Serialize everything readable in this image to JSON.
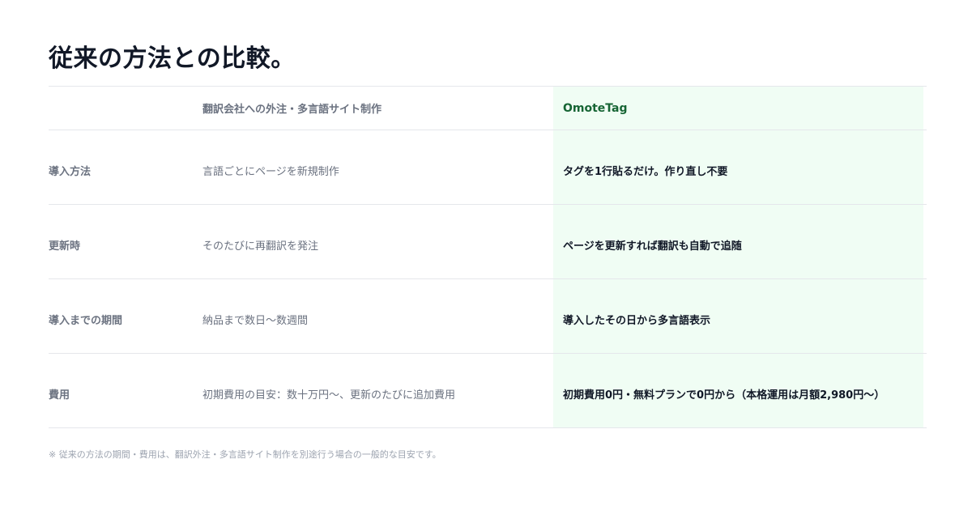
{
  "title": "従来の方法との比較。",
  "columns": {
    "old": "翻訳会社への外注・多言語サイト制作",
    "new": "OmoteTag"
  },
  "rows": [
    {
      "label": "導入方法",
      "old": "言語ごとにページを新規制作",
      "new": "タグを1行貼るだけ。作り直し不要"
    },
    {
      "label": "更新時",
      "old": "そのたびに再翻訳を発注",
      "new": "ページを更新すれば翻訳も自動で追随"
    },
    {
      "label": "導入までの期間",
      "old": "納品まで数日〜数週間",
      "new": "導入したその日から多言語表示"
    },
    {
      "label": "費用",
      "old": "初期費用の目安：数十万円〜、更新のたびに追加費用",
      "new": "初期費用0円・無料プランで0円から（本格運用は月額2,980円〜）"
    }
  ],
  "note": "※ 従来の方法の期間・費用は、翻訳外注・多言語サイト制作を別途行う場合の一般的な目安です。",
  "colors": {
    "accent_bg": "#f0fdf4",
    "accent_text": "#166534",
    "title": "#111827",
    "muted": "#6b7280",
    "border": "#e5e7eb"
  }
}
